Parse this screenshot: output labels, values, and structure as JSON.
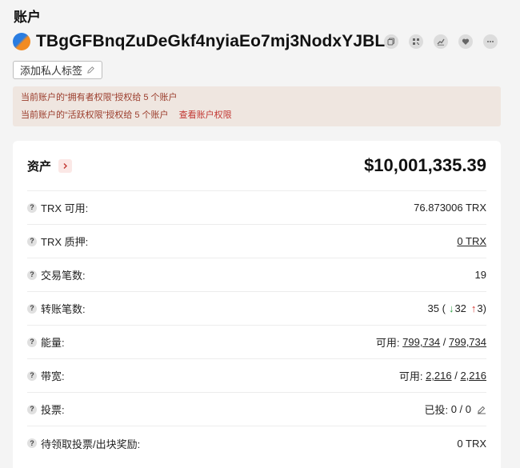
{
  "page": {
    "title": "账户"
  },
  "account": {
    "address": "TBgGFBnqZuDeGkf4nyiaEo7mj3NodxYJBL",
    "actions": [
      "copy-icon",
      "qrcode-icon",
      "chart-icon",
      "heart-icon",
      "more-icon"
    ],
    "tag_label": "添加私人标签"
  },
  "permissions": {
    "owner_text": "当前账户的“拥有者权限”授权给 5 个账户",
    "active_text": "当前账户的“活跃权限”授权给 5 个账户",
    "view_link": "查看账户权限"
  },
  "assets": {
    "title": "资产",
    "total": "$10,001,335.39",
    "rows": [
      {
        "label": "TRX 可用:",
        "value": "76.873006 TRX"
      },
      {
        "label": "TRX 质押:",
        "value": "0 TRX"
      },
      {
        "label": "交易笔数:",
        "value": "19"
      },
      {
        "label": "转账笔数:",
        "total": "35",
        "in": "32",
        "out": "3"
      },
      {
        "label": "能量:",
        "prefix": "可用:",
        "available": "799,734",
        "limit": "799,734"
      },
      {
        "label": "带宽:",
        "prefix": "可用:",
        "available": "2,216",
        "limit": "2,216"
      },
      {
        "label": "投票:",
        "prefix": "已投:",
        "value": "0 / 0"
      },
      {
        "label": "待领取投票/出块奖励:",
        "value": "0 TRX"
      }
    ]
  },
  "colors": {
    "accent": "#c23631",
    "warn_bg": "#efe6e0",
    "in": "#2ea043",
    "out": "#d4302b"
  }
}
